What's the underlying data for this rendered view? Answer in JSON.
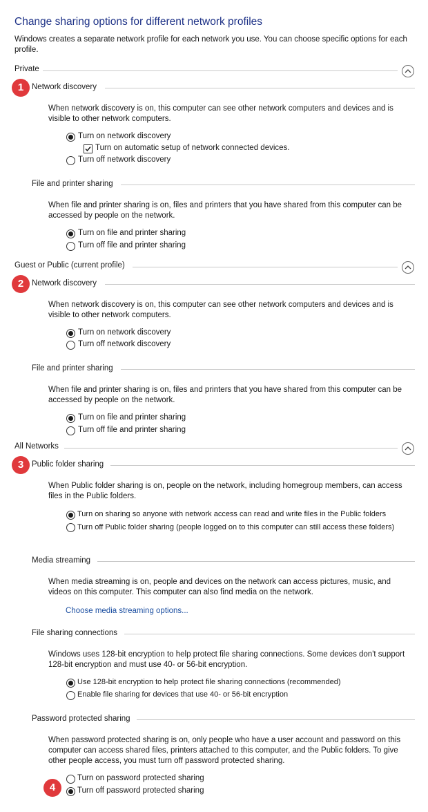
{
  "title": "Change sharing options for different network profiles",
  "intro": "Windows creates a separate network profile for each network you use. You can choose specific options for each profile.",
  "badges": [
    "1",
    "2",
    "3",
    "4"
  ],
  "private": {
    "header": "Private",
    "network_discovery": {
      "title": "Network discovery",
      "desc": "When network discovery is on, this computer can see other network computers and devices and is visible to other network computers.",
      "opt_on": "Turn on network discovery",
      "auto_setup": "Turn on automatic setup of network connected devices.",
      "auto_setup_checked": true,
      "opt_off": "Turn off network discovery",
      "selected": "on"
    },
    "file_printer": {
      "title": "File and printer sharing",
      "desc": "When file and printer sharing is on, files and printers that you have shared from this computer can be accessed by people on the network.",
      "opt_on": "Turn on file and printer sharing",
      "opt_off": "Turn off file and printer sharing",
      "selected": "on"
    }
  },
  "guest": {
    "header": "Guest or Public (current profile)",
    "network_discovery": {
      "title": "Network discovery",
      "desc": "When network discovery is on, this computer can see other network computers and devices and is visible to other network computers.",
      "opt_on": "Turn on network discovery",
      "opt_off": "Turn off network discovery",
      "selected": "on"
    },
    "file_printer": {
      "title": "File and printer sharing",
      "desc": "When file and printer sharing is on, files and printers that you have shared from this computer can be accessed by people on the network.",
      "opt_on": "Turn on file and printer sharing",
      "opt_off": "Turn off file and printer sharing",
      "selected": "on"
    }
  },
  "all": {
    "header": "All Networks",
    "public_folder": {
      "title": "Public folder sharing",
      "desc": "When Public folder sharing is on, people on the network, including homegroup members, can access files in the Public folders.",
      "opt_on": "Turn on sharing so anyone with network access can read and write files in the Public folders",
      "opt_off": "Turn off Public folder sharing (people logged on to this computer can still access these folders)",
      "selected": "on"
    },
    "media": {
      "title": "Media streaming",
      "desc": "When media streaming is on, people and devices on the network can access pictures, music, and videos on this computer. This computer can also find media on the network.",
      "link": "Choose media streaming options..."
    },
    "file_conn": {
      "title": "File sharing connections",
      "desc": "Windows uses 128-bit encryption to help protect file sharing connections. Some devices don't support 128-bit encryption and must use 40- or 56-bit encryption.",
      "opt_128": "Use 128-bit encryption to help protect file sharing connections (recommended)",
      "opt_40": "Enable file sharing for devices that use 40- or 56-bit encryption",
      "selected": "128"
    },
    "password": {
      "title": "Password protected sharing",
      "desc": "When password protected sharing is on, only people who have a user account and password on this computer can access shared files, printers attached to this computer, and the Public folders. To give other people access, you must turn off password protected sharing.",
      "opt_on": "Turn on password protected sharing",
      "opt_off": "Turn off password protected sharing",
      "selected": "off"
    }
  }
}
